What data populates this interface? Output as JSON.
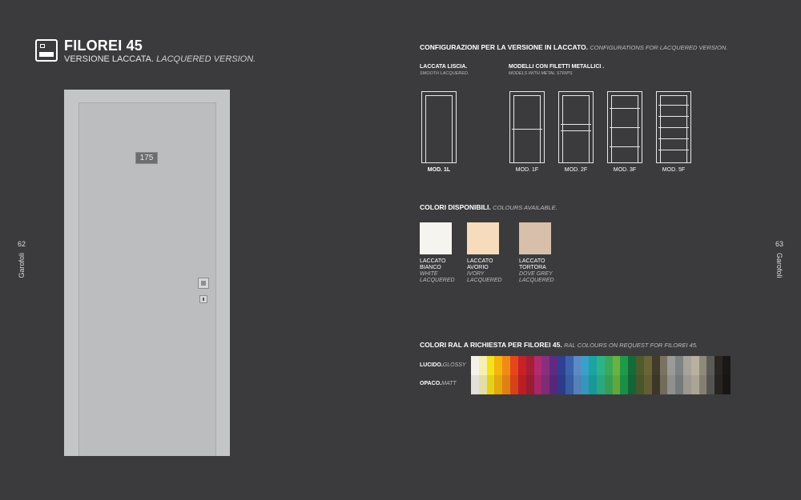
{
  "left_page": {
    "title": "FILOREI 45",
    "subtitle_it": "VERSIONE LACCATA.",
    "subtitle_en": "LACQUERED VERSION.",
    "page_number": "62",
    "brand": "Garofoli",
    "door_number": "175"
  },
  "right_page": {
    "page_number": "63",
    "brand": "Garofoli",
    "config_title_it": "CONFIGURAZIONI PER LA VERSIONE IN LACCATO.",
    "config_title_en": "CONFIGURATIONS FOR LACQUERED VERSION.",
    "smooth": {
      "title": "LACCATA LISCIA.",
      "subtitle": "SMOOTH LACQUERED."
    },
    "strips": {
      "title": "MODELLI CON FILETTI METALLICI .",
      "subtitle": "MODELS WITH METAL STRIPS"
    },
    "models": [
      {
        "label": "MOD. 1L",
        "strips": 0
      },
      {
        "label": "MOD. 1F",
        "strips": 1
      },
      {
        "label": "MOD. 2F",
        "strips": 2
      },
      {
        "label": "MOD. 3F",
        "strips": 3
      },
      {
        "label": "MOD. 5F",
        "strips": 5
      }
    ],
    "colors_title_it": "COLORI DISPONIBILI.",
    "colors_title_en": "COLOURS AVAILABLE.",
    "colors": [
      {
        "line1": "LACCATO",
        "line2": "BIANCO",
        "en1": "WHITE",
        "en2": "LACQUERED",
        "hex": "#f6f4ee"
      },
      {
        "line1": "LACCATO",
        "line2": "AVORIO",
        "en1": "IVORY",
        "en2": "LACQUERED",
        "hex": "#f6dcbc"
      },
      {
        "line1": "LACCATO",
        "line2": "TORTORA",
        "en1": "DOVE GREY",
        "en2": "LACQUERED",
        "hex": "#d8bfab"
      }
    ],
    "ral_title_it": "COLORI RAL  A RICHIESTA PER FILOREI 45.",
    "ral_title_en": "RAL COLOURS ON REQUEST FOR FILOREI 45.",
    "glossy_it": "LUCIDO.",
    "glossy_en": "GLOSSY",
    "matt_it": "OPACO.",
    "matt_en": "MATT",
    "ral_colors": [
      "#f3f1ea",
      "#f6efb0",
      "#f6e21a",
      "#f5b40f",
      "#f08a17",
      "#e6461c",
      "#c82027",
      "#a61e36",
      "#b42a72",
      "#8a2f7e",
      "#5e2a82",
      "#2f3f94",
      "#3b63ad",
      "#5b8ac6",
      "#3aa0c8",
      "#1aa5a3",
      "#2db38a",
      "#3aaa5a",
      "#6cb241",
      "#1d9a4a",
      "#146b3a",
      "#4e5c2c",
      "#6b6438",
      "#423a2a",
      "#7b7362",
      "#9a9a98",
      "#7d8283",
      "#a8a39a",
      "#b8b1a0",
      "#8f8979",
      "#5c5a56",
      "#2a2624",
      "#1a1817"
    ]
  }
}
